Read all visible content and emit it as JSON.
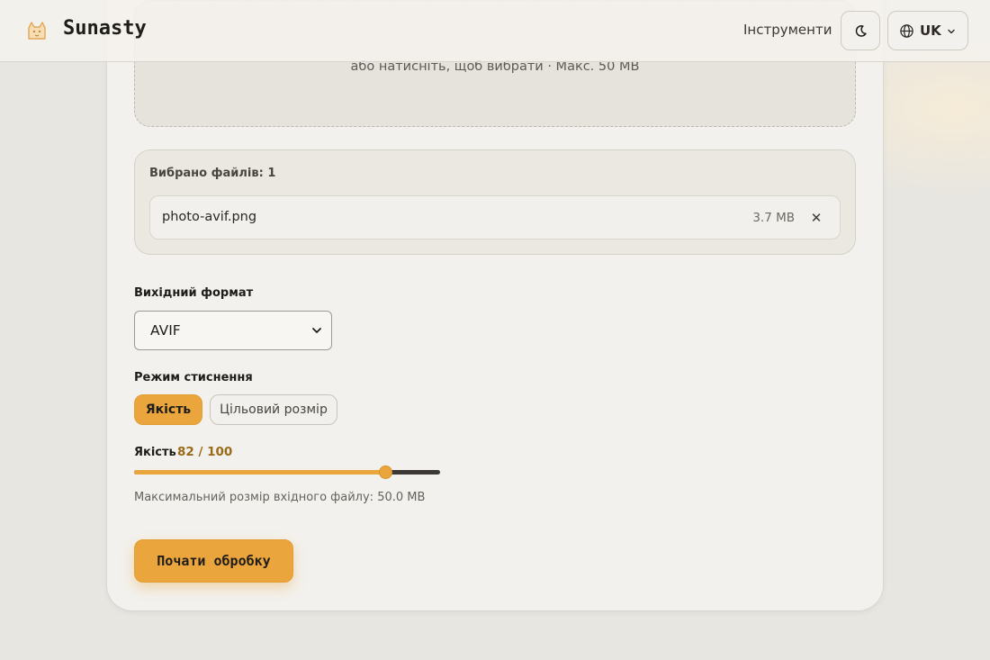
{
  "header": {
    "brand": "Sunasty",
    "logo_icon": "cat-logo-icon",
    "nav_tools_label": "Інструменти",
    "theme_icon": "moon-icon",
    "language_icon": "globe-icon",
    "language_code": "UK"
  },
  "upload": {
    "hint": "або натисніть, щоб вибрати · Макс. 50 MB"
  },
  "files": {
    "count_label": "Вибрано файлів: 1",
    "items": [
      {
        "name": "photo-avif.png",
        "size": "3.7 MB",
        "remove_icon": "close-icon"
      }
    ]
  },
  "output_format": {
    "label": "Вихідний формат",
    "selected": "AVIF"
  },
  "compression_mode": {
    "label": "Режим стиснення",
    "options": [
      {
        "label": "Якість",
        "active": true
      },
      {
        "label": "Цільовий розмір",
        "active": false
      }
    ]
  },
  "quality": {
    "label": "Якість",
    "value_text": "82 / 100",
    "value": 82,
    "max": 100
  },
  "max_input_note": "Максимальний розмір вхідного файлу: 50.0 MB",
  "start_button_label": "Почати обробку",
  "colors": {
    "accent": "#eba53d",
    "accent_text": "#9a6a17",
    "background": "#e8e6e1",
    "card": "#f3f1ed"
  }
}
